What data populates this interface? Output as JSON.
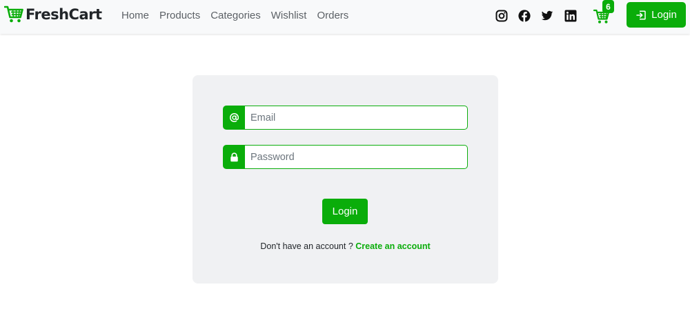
{
  "brand": {
    "name": "FreshCart",
    "accent": "#0aad0a"
  },
  "nav": {
    "links": [
      "Home",
      "Products",
      "Categories",
      "Wishlist",
      "Orders"
    ]
  },
  "social": [
    "instagram-icon",
    "facebook-icon",
    "twitter-icon",
    "linkedin-icon"
  ],
  "cart": {
    "count": "6"
  },
  "nav_login": {
    "label": "Login"
  },
  "login_form": {
    "email_placeholder": "Email",
    "email_value": "",
    "password_placeholder": "Password",
    "password_value": "",
    "submit_label": "Login",
    "no_account_text": "Don't have an account ?",
    "create_account_label": "Create an account"
  }
}
